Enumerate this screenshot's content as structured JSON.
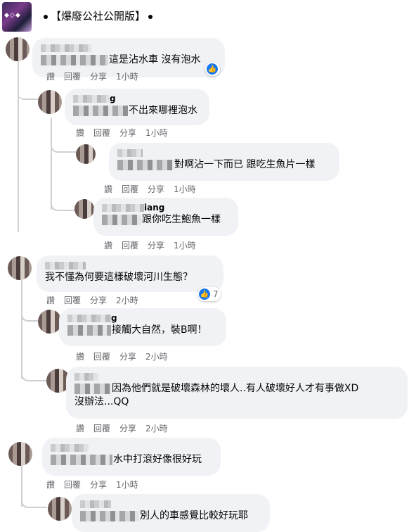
{
  "group": {
    "title": "【爆廢公社公開版】"
  },
  "actions": {
    "like": "讚",
    "reply": "回覆",
    "share": "分享"
  },
  "comments": [
    {
      "name_suffix": "",
      "text": "這是沾水車 沒有泡水",
      "time": "1小時",
      "reaction_count": ""
    },
    {
      "name_suffix": "g",
      "text": "不出來哪裡泡水",
      "time": "1小時"
    },
    {
      "name_suffix": "",
      "text": "對啊沾一下而已 跟吃生魚片一樣",
      "time": "1小時"
    },
    {
      "name_suffix": "iang",
      "text": "跟你吃生鮑魚一樣",
      "time": "1小時"
    },
    {
      "name_suffix": "",
      "text": "我不懂為何要這樣破壞河川生態？",
      "time": "2小時",
      "reaction_count": "7"
    },
    {
      "name_suffix": "g",
      "text": "接觸大自然，裝B啊！",
      "time": "2小時"
    },
    {
      "name_suffix": "",
      "text": "因為他們就是破壞森林的壞人..有人破壞好人才有事做XD",
      "text2": "沒辦法...QQ",
      "time": "2小時"
    },
    {
      "name_suffix": "",
      "text": "水中打滾好像很好玩",
      "time": "1小時"
    },
    {
      "name_suffix": "",
      "text": "別人的車感覺比較好玩耶",
      "time": ""
    }
  ]
}
